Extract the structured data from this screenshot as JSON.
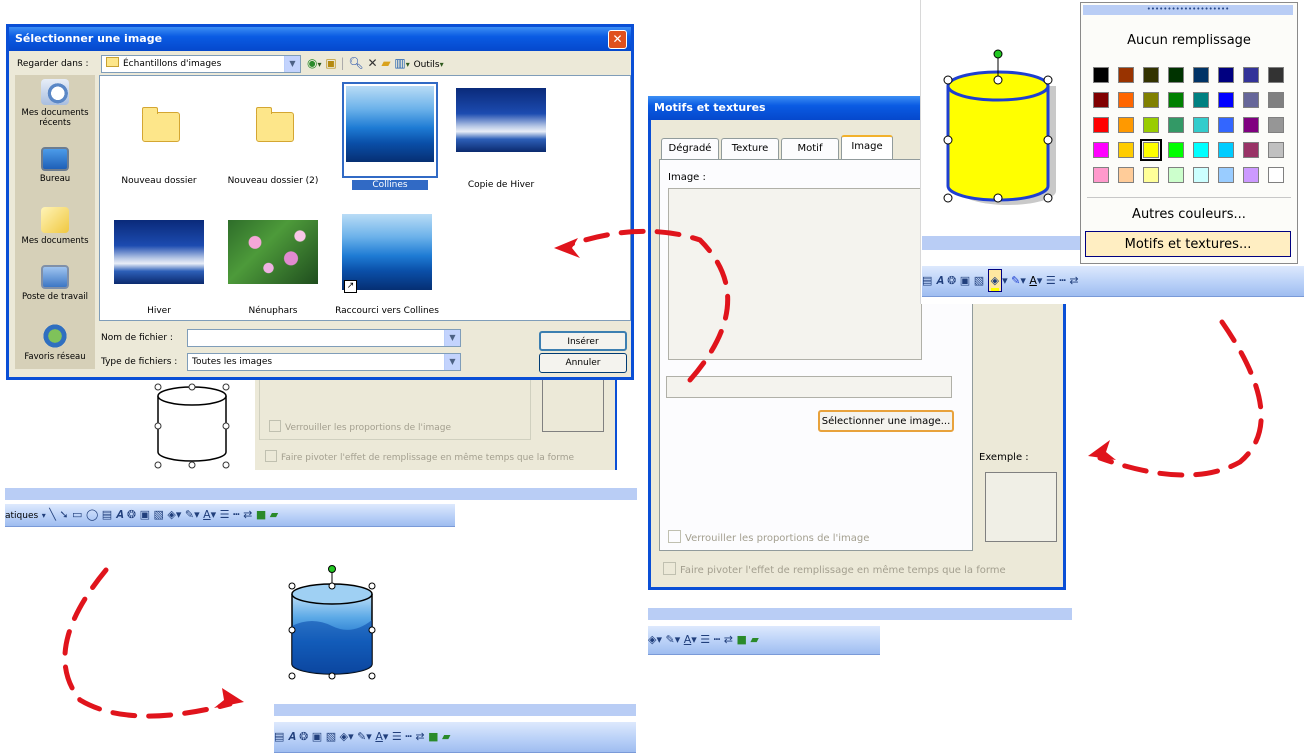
{
  "file_dialog": {
    "title": "Sélectionner une image",
    "look_in_label": "Regarder dans :",
    "look_in_value": "Échantillons d'images",
    "tools_label": "Outils",
    "places": [
      {
        "label": "Mes documents récents",
        "icon": "recent-documents-icon"
      },
      {
        "label": "Bureau",
        "icon": "desktop-icon"
      },
      {
        "label": "Mes documents",
        "icon": "my-documents-icon"
      },
      {
        "label": "Poste de travail",
        "icon": "my-computer-icon"
      },
      {
        "label": "Favoris réseau",
        "icon": "network-places-icon"
      }
    ],
    "files": [
      {
        "name": "Nouveau dossier",
        "kind": "folder"
      },
      {
        "name": "Nouveau dossier (2)",
        "kind": "folder"
      },
      {
        "name": "Collines",
        "kind": "image",
        "selected": true
      },
      {
        "name": "Copie de Hiver",
        "kind": "image"
      },
      {
        "name": "Hiver",
        "kind": "image"
      },
      {
        "name": "Nénuphars",
        "kind": "image"
      },
      {
        "name": "Raccourci vers Collines",
        "kind": "shortcut"
      }
    ],
    "filename_label": "Nom de fichier :",
    "filename_value": "",
    "filetype_label": "Type de fichiers :",
    "filetype_value": "Toutes les images",
    "insert_button": "Insérer",
    "cancel_button": "Annuler"
  },
  "behind_dialog": {
    "lock_ratio": "Verrouiller les proportions de l'image",
    "rotate_fill": "Faire pivoter l'effet de remplissage en même temps que la forme"
  },
  "fill_dialog": {
    "title": "Motifs et textures",
    "tabs": [
      "Dégradé",
      "Texture",
      "Motif",
      "Image"
    ],
    "active_tab": "Image",
    "image_label": "Image :",
    "select_image_button": "Sélectionner une image...",
    "lock_ratio": "Verrouiller les proportions de l'image",
    "rotate_fill": "Faire pivoter l'effet de remplissage en même temps que la forme",
    "sample_label": "Exemple :"
  },
  "color_menu": {
    "no_fill": "Aucun remplissage",
    "more_colors": "Autres couleurs...",
    "fill_effects": "Motifs et textures...",
    "colors": [
      [
        "#000000",
        "#993300",
        "#333300",
        "#003300",
        "#003366",
        "#000080",
        "#333399",
        "#333333"
      ],
      [
        "#800000",
        "#ff6600",
        "#808000",
        "#008000",
        "#008080",
        "#0000ff",
        "#666699",
        "#808080"
      ],
      [
        "#ff0000",
        "#ff9900",
        "#99cc00",
        "#339966",
        "#33cccc",
        "#3366ff",
        "#800080",
        "#969696"
      ],
      [
        "#ff00ff",
        "#ffcc00",
        "#ffff00",
        "#00ff00",
        "#00ffff",
        "#00ccff",
        "#993366",
        "#c0c0c0"
      ],
      [
        "#ff99cc",
        "#ffcc99",
        "#ffff99",
        "#ccffcc",
        "#ccffff",
        "#99ccff",
        "#cc99ff",
        "#ffffff"
      ]
    ],
    "selected_color": "#ffff00"
  },
  "drawing_toolbar": {
    "partial_label": "atiques"
  }
}
